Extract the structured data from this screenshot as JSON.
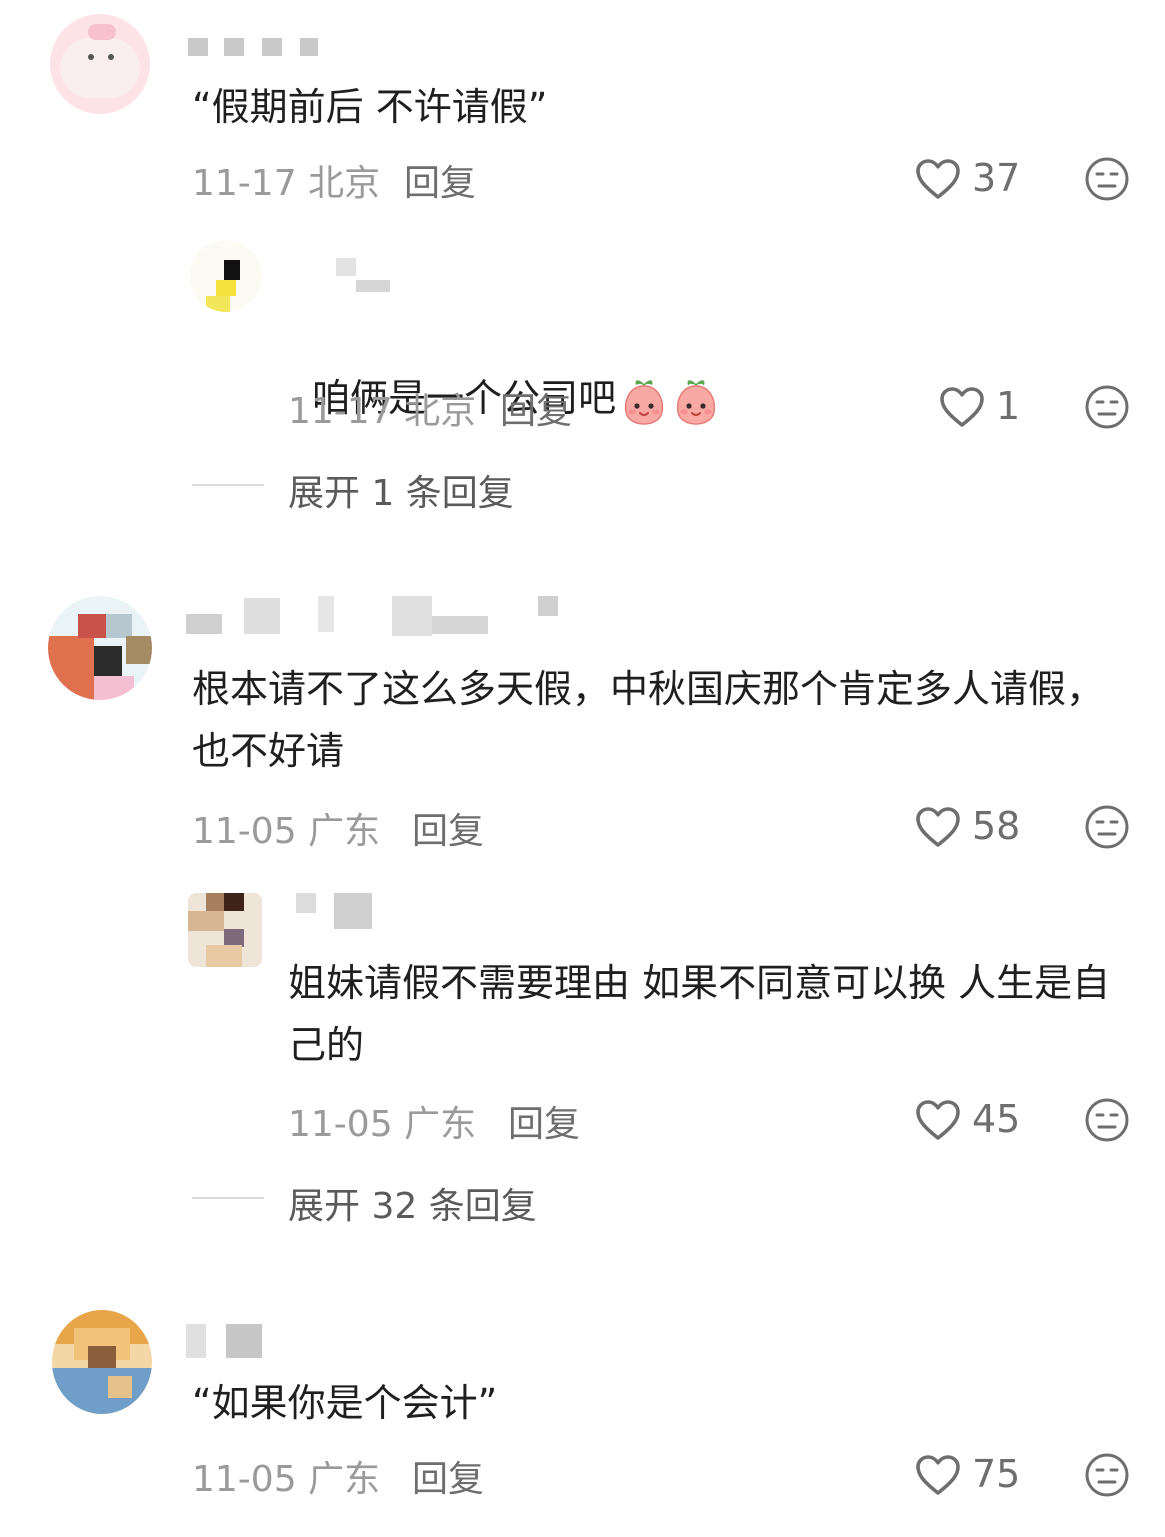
{
  "comments": [
    {
      "text": "“假期前后 不许请假”",
      "date": "11-17",
      "location": "北京",
      "reply_label": "回复",
      "likes": "37",
      "reply": {
        "text": "咱俩是一个公司吧",
        "emoji": [
          "peach-face-emoji",
          "peach-face-emoji"
        ],
        "date": "11-17",
        "location": "北京",
        "reply_label": "回复",
        "likes": "1"
      },
      "expand": "展开 1 条回复"
    },
    {
      "text": "根本请不了这么多天假，中秋国庆那个肯定多人请假，也不好请",
      "date": "11-05",
      "location": "广东",
      "reply_label": "回复",
      "likes": "58",
      "reply": {
        "text": "姐妹请假不需要理由 如果不同意可以换 人生是自己的",
        "date": "11-05",
        "location": "广东",
        "reply_label": "回复",
        "likes": "45"
      },
      "expand": "展开 32 条回复"
    },
    {
      "text": "“如果你是个会计”",
      "date": "11-05",
      "location": "广东",
      "reply_label": "回复",
      "likes": "75"
    }
  ],
  "icons": {
    "like": "heart-outline-icon",
    "dislike": "neutral-face-icon"
  },
  "colors": {
    "text": "#1f1f1f",
    "meta": "#9a9a9a",
    "icon": "#6e6e6e"
  }
}
